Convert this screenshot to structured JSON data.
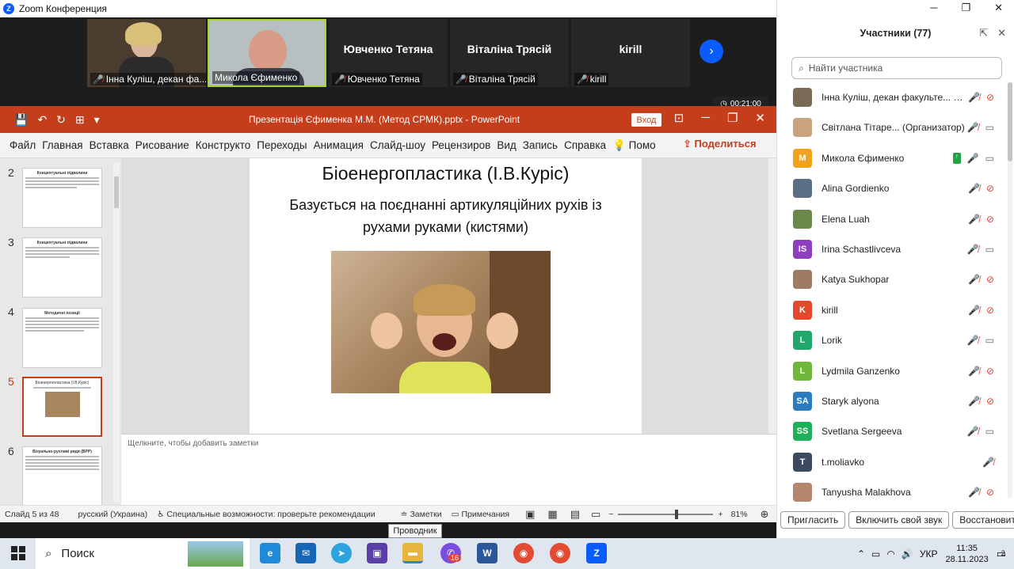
{
  "zoom": {
    "title": "Zoom Конференция",
    "gallery": [
      {
        "caption": "Інна Куліш, декан фа...",
        "has_video": true,
        "tile_name": ""
      },
      {
        "caption": "Микола Єфименко",
        "has_video": true,
        "tile_name": ""
      },
      {
        "caption": "Ювченко Тетяна",
        "has_video": false,
        "tile_name": "Ювченко Тетяна"
      },
      {
        "caption": "Віталіна Трясій",
        "has_video": false,
        "tile_name": "Віталіна Трясій"
      },
      {
        "caption": "kirill",
        "has_video": false,
        "tile_name": "kirill"
      }
    ],
    "timer": "00:21:00"
  },
  "ppt": {
    "doc_title": "Презентація Єфименка М.М. (Метод СРМК).pptx  -  PowerPoint",
    "login": "Вход",
    "tabs": [
      "Файл",
      "Главная",
      "Вставка",
      "Рисование",
      "Конструкто",
      "Переходы",
      "Анимация",
      "Слайд-шоу",
      "Рецензиров",
      "Вид",
      "Запись",
      "Справка"
    ],
    "search_short": "Помо",
    "share": "Поделиться",
    "thumbs": [
      {
        "num": "2",
        "title": "Концептуальні підвалини"
      },
      {
        "num": "3",
        "title": "Концептуальні підвалини"
      },
      {
        "num": "4",
        "title": "Методичні позиції"
      },
      {
        "num": "5",
        "title": "Біоенергопластика (І.В.Куріс)"
      },
      {
        "num": "6",
        "title": "Візуально-рухливі ряди (ВРР)"
      }
    ],
    "slide": {
      "title": "Біоенергопластика (І.В.Куріс)",
      "subtitle": "Базується на поєднанні артикуляційних рухів із рухами руками (кистями)"
    },
    "notes_placeholder": "Щелкните, чтобы добавить заметки",
    "status": {
      "slide": "Слайд 5 из 48",
      "lang": "русский (Украина)",
      "accessibility": "Специальные возможности: проверьте рекомендации",
      "notes": "Заметки",
      "comments": "Примечания",
      "zoom": "81%"
    },
    "tooltip": "Проводник"
  },
  "participants": {
    "title": "Участники (77)",
    "search_placeholder": "Найти участника",
    "list": [
      {
        "name": "Інна Куліш, декан факульте... (Я)",
        "initials": "",
        "color": "#7a6a55",
        "mic": "off",
        "cam": "off",
        "share": false
      },
      {
        "name": "Світлана Тітаре... (Организатор)",
        "initials": "",
        "color": "#c9a27e",
        "mic": "off",
        "cam": "on",
        "share": false
      },
      {
        "name": "Микола Єфименко",
        "initials": "M",
        "color": "#f0a21e",
        "mic": "on",
        "cam": "on",
        "share": true
      },
      {
        "name": "Alina Gordienko",
        "initials": "",
        "color": "#5a6e86",
        "mic": "off",
        "cam": "off",
        "share": false
      },
      {
        "name": "Elena Luah",
        "initials": "",
        "color": "#6b8a4a",
        "mic": "off",
        "cam": "off",
        "share": false
      },
      {
        "name": "Irina Schastlivceva",
        "initials": "IS",
        "color": "#8e3fbf",
        "mic": "off",
        "cam": "on",
        "share": false
      },
      {
        "name": "Katya Sukhopar",
        "initials": "",
        "color": "#a07a62",
        "mic": "off",
        "cam": "off",
        "share": false
      },
      {
        "name": "kirill",
        "initials": "K",
        "color": "#e34a2d",
        "mic": "off",
        "cam": "off",
        "share": false
      },
      {
        "name": "Lorik",
        "initials": "L",
        "color": "#1fa86a",
        "mic": "off",
        "cam": "on",
        "share": false
      },
      {
        "name": "Lydmila Ganzenko",
        "initials": "L",
        "color": "#6fb83a",
        "mic": "off",
        "cam": "off",
        "share": false
      },
      {
        "name": "Staryk alyona",
        "initials": "SA",
        "color": "#2a7bc0",
        "mic": "off",
        "cam": "off",
        "share": false
      },
      {
        "name": "Svetlana Sergeeva",
        "initials": "SS",
        "color": "#1fae59",
        "mic": "off",
        "cam": "on",
        "share": false
      },
      {
        "name": "t.moliavko",
        "initials": "T",
        "color": "#3b4a5e",
        "mic": "off",
        "cam": "none",
        "share": false
      },
      {
        "name": "Tanyusha Malakhova",
        "initials": "",
        "color": "#b3876b",
        "mic": "off",
        "cam": "off",
        "share": false
      }
    ],
    "buttons": [
      "Пригласить",
      "Включить свой звук",
      "Восстановить"
    ]
  },
  "taskbar": {
    "search": "Поиск",
    "badge": "16",
    "lang": "УКР",
    "time": "11:35",
    "date": "28.11.2023",
    "notif": "2"
  }
}
